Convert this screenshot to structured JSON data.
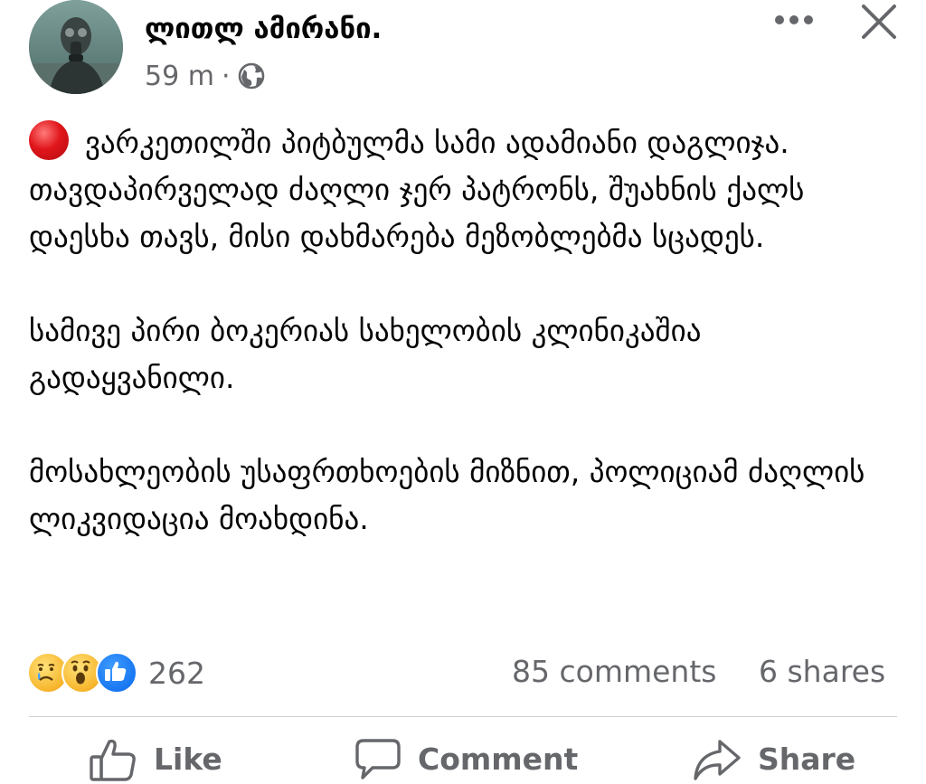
{
  "post": {
    "author": "ლითლ ამირანი.",
    "time": "59 m",
    "separator": "·",
    "audience_icon": "globe-icon",
    "paragraphs": [
      "ვარკეთილში პიტბულმა სამი ადამიანი დაგლიჯა. თავდაპირველად ძაღლი ჯერ პატრონს, შუახნის ქალს დაესხა თავს, მისი დახმარება მეზობლებმა სცადეს.",
      "სამივე პირი ბოკერიას სახელობის კლინიკაშია გადაყვანილი.",
      "მოსახლეობის უსაფრთხოების მიზნით, პოლიციამ ძაღლის ლიკვიდაცია მოახდინა."
    ]
  },
  "stats": {
    "reactions": [
      "sad",
      "wow",
      "like"
    ],
    "reaction_count": "262",
    "comments": "85 comments",
    "shares": "6 shares"
  },
  "actions": {
    "like": "Like",
    "comment": "Comment",
    "share": "Share"
  },
  "colors": {
    "text": "#050505",
    "secondary": "#65676b",
    "divider": "#ced0d4",
    "like_blue": "#1877f2",
    "alert_red": "#e0161b"
  }
}
